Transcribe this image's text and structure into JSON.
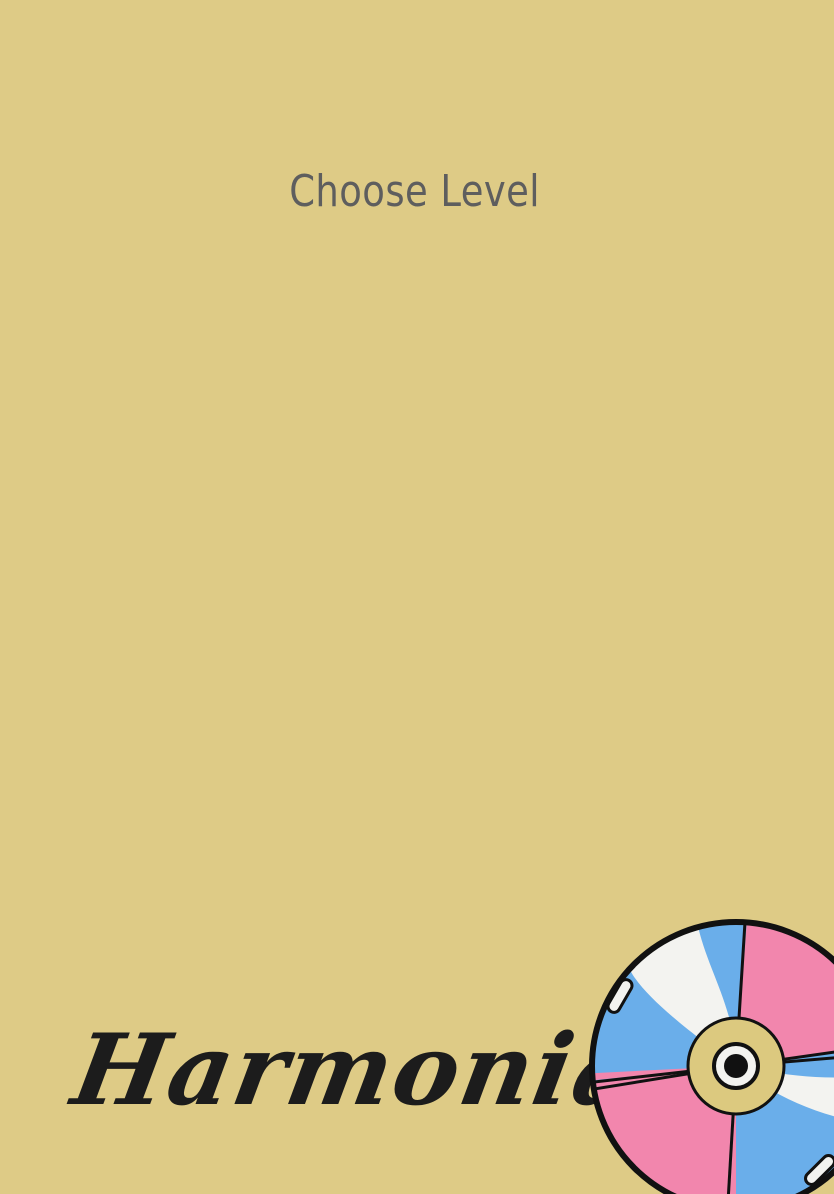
{
  "screen": {
    "background": "#decb86"
  },
  "header": {
    "title": "Choose Level",
    "title_color": "#5e5e5e"
  },
  "branding": {
    "wordmark": "Harmonia",
    "wordmark_color": "#1c1c1c",
    "disc_icon": "vinyl-disc-icon",
    "disc_colors": {
      "pink": "#f286ad",
      "blue": "#6aaeea",
      "white": "#f3f3f0",
      "hub": "#dcc97f",
      "outline": "#111111"
    }
  },
  "level_list": {
    "levels": []
  }
}
